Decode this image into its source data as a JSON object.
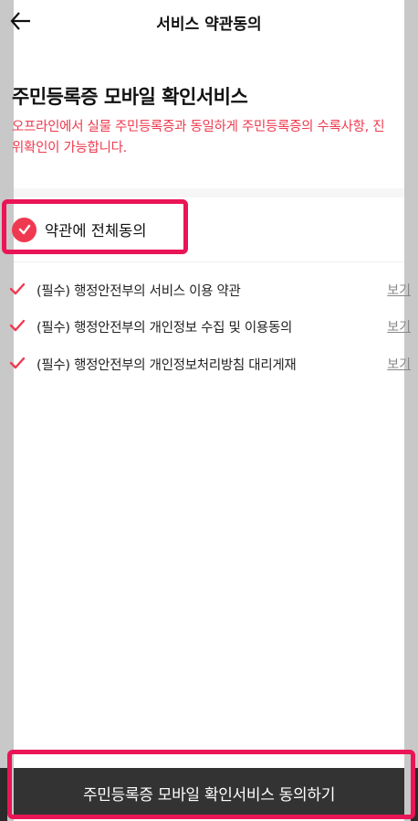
{
  "header": {
    "title": "서비스 약관동의",
    "back_icon": "arrow-left-icon"
  },
  "main": {
    "title": "주민등록증 모바일 확인서비스",
    "description": "오프라인에서 실물 주민등록증과 동일하게 주민등록증의 수록사항, 진위확인이 가능합니다."
  },
  "agree_all": {
    "label": "약관에 전체동의",
    "checked": true
  },
  "terms": [
    {
      "label": "(필수) 행정안전부의 서비스 이용 약관",
      "view_label": "보기",
      "checked": true
    },
    {
      "label": "(필수) 행정안전부의 개인정보 수집 및 이용동의",
      "view_label": "보기",
      "checked": true
    },
    {
      "label": "(필수) 행정안전부의 개인정보처리방침 대리게재",
      "view_label": "보기",
      "checked": true
    }
  ],
  "cta": {
    "label": "주민등록증 모바일 확인서비스 동의하기"
  },
  "colors": {
    "accent": "#ef3950",
    "description_text": "#ee3b4f",
    "button_bg": "#333333",
    "highlight": "#ea1556"
  }
}
